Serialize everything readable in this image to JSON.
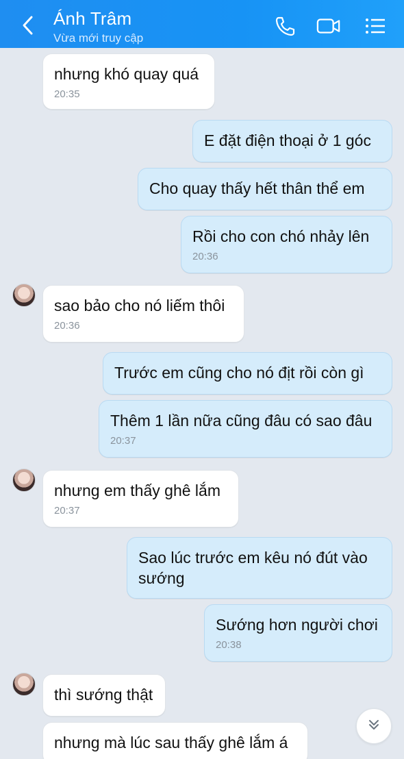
{
  "header": {
    "title": "Ánh Trâm",
    "subtitle": "Vừa mới truy cập",
    "icons": [
      "back-chevron-icon",
      "phone-icon",
      "video-call-icon",
      "menu-list-icon"
    ]
  },
  "messages": [
    {
      "side": "in",
      "text": "nhưng khó quay quá",
      "time": "20:35"
    },
    {
      "side": "out",
      "text": "E đặt điện thoại ở 1 góc",
      "time": ""
    },
    {
      "side": "out",
      "text": "Cho quay thấy hết thân thể em",
      "time": ""
    },
    {
      "side": "out",
      "text": "Rồi cho con chó nhảy lên",
      "time": "20:36"
    },
    {
      "side": "in",
      "text": "sao bảo cho nó liếm thôi",
      "time": "20:36"
    },
    {
      "side": "out",
      "text": "Trước em cũng cho nó địt rồi còn gì",
      "time": ""
    },
    {
      "side": "out",
      "text": "Thêm 1 lần nữa cũng đâu có sao đâu",
      "time": "20:37"
    },
    {
      "side": "in",
      "text": "nhưng em thấy ghê lắm",
      "time": "20:37"
    },
    {
      "side": "out",
      "text": "Sao lúc trước em kêu nó đút vào sướng",
      "time": ""
    },
    {
      "side": "out",
      "text": "Sướng hơn người chơi",
      "time": "20:38"
    },
    {
      "side": "in",
      "text": "thì sướng thật",
      "time": ""
    },
    {
      "side": "in",
      "text": "nhưng mà lúc sau thấy ghê lắm á",
      "time": ""
    }
  ],
  "colors": {
    "header": "#1f8ef1",
    "background": "#e3e8ef",
    "incoming_bubble": "#ffffff",
    "outgoing_bubble": "#d5ecfb"
  }
}
